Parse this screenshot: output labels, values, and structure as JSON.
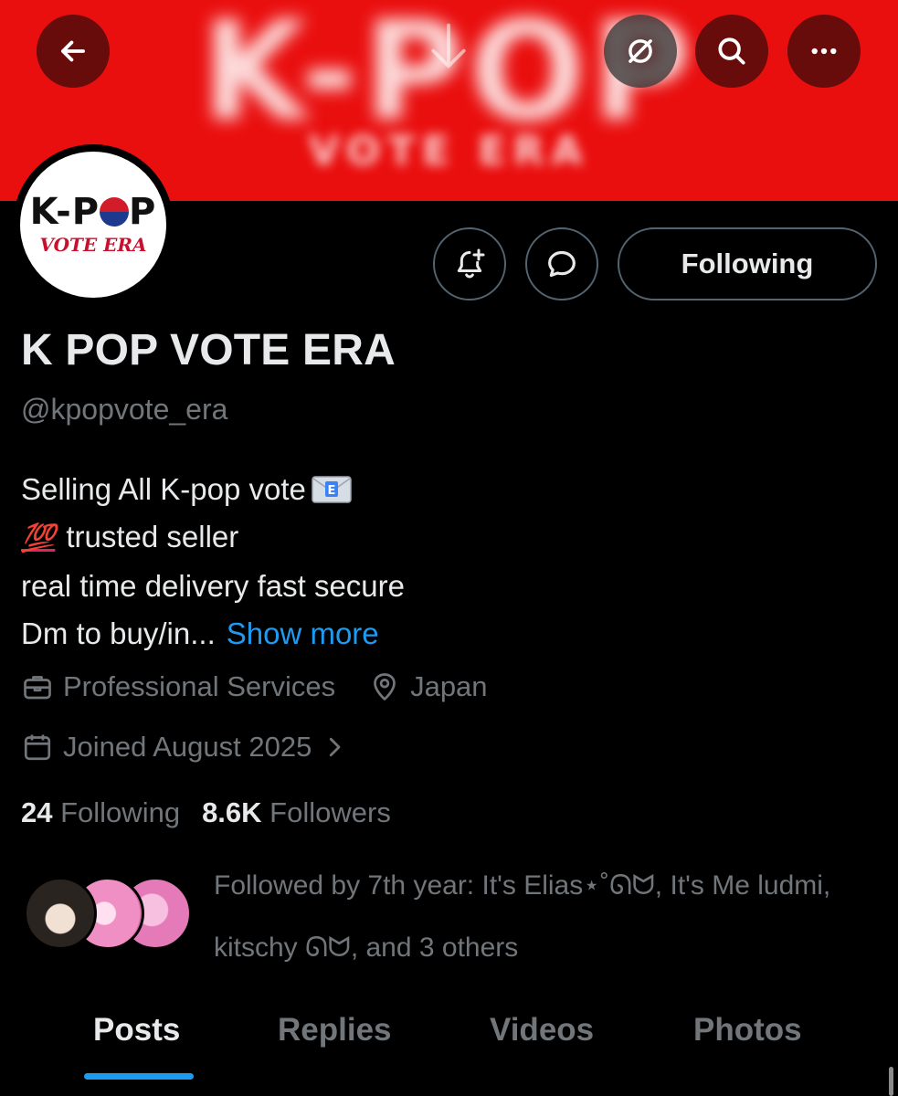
{
  "banner": {
    "title": "K-POP",
    "subtitle": "VOTE ERA",
    "color": "#ea0f0f"
  },
  "top_bar": {
    "back_icon": "arrow-left-icon",
    "pull_icon": "arrow-down-icon",
    "grok_icon": "grok-icon",
    "search_icon": "search-icon",
    "more_icon": "more-horizontal-icon"
  },
  "avatar": {
    "title_left": "K-P",
    "title_right": "P",
    "subtitle": "VOTE ERA"
  },
  "actions": {
    "notify_icon": "bell-plus-icon",
    "message_icon": "chat-bubble-icon",
    "following_label": "Following"
  },
  "profile": {
    "name": "K POP VOTE ERA",
    "handle": "@kpopvote_era",
    "bio": {
      "line1": "Selling All K-pop vote",
      "line2_emoji": "💯",
      "line2": "trusted seller",
      "line3": "real time delivery fast secure",
      "line4": "Dm to buy/in...",
      "show_more": "Show more"
    },
    "category": "Professional Services",
    "location": "Japan",
    "joined": "Joined August 2025"
  },
  "stats": {
    "following_count": "24",
    "following_label": "Following",
    "followers_count": "8.6K",
    "followers_label": "Followers"
  },
  "followed_by": {
    "text": "Followed by 7th year: It's Elias⋆˚ᘏᗢ, It's Me ludmi, kitschy ᘏᗢ, and 3 others"
  },
  "tabs": [
    "Posts",
    "Replies",
    "Videos",
    "Photos"
  ],
  "colors": {
    "accent": "#1d9bf0",
    "muted": "#71767b",
    "text": "#e7e9ea"
  }
}
